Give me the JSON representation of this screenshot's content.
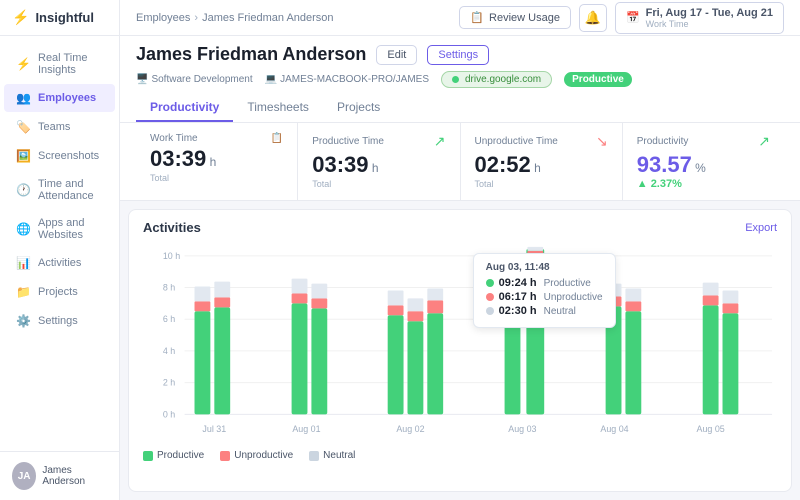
{
  "app": {
    "name": "Insightful"
  },
  "sidebar": {
    "items": [
      {
        "id": "realtime",
        "label": "Real Time Insights",
        "icon": "⚡"
      },
      {
        "id": "employees",
        "label": "Employees",
        "icon": "👥",
        "active": true
      },
      {
        "id": "teams",
        "label": "Teams",
        "icon": "🏷️"
      },
      {
        "id": "screenshots",
        "label": "Screenshots",
        "icon": "🖼️"
      },
      {
        "id": "timeattendance",
        "label": "Time and Attendance",
        "icon": "🕐"
      },
      {
        "id": "appswebsites",
        "label": "Apps and Websites",
        "icon": "🌐"
      },
      {
        "id": "activities",
        "label": "Activities",
        "icon": "📊"
      },
      {
        "id": "projects",
        "label": "Projects",
        "icon": "📁"
      },
      {
        "id": "settings",
        "label": "Settings",
        "icon": "⚙️"
      }
    ],
    "user": {
      "name": "James Anderson",
      "initials": "JA"
    }
  },
  "topbar": {
    "breadcrumb": {
      "parent": "Employees",
      "current": "James Friedman Anderson"
    },
    "review_button": "Review Usage",
    "date_range": "Fri, Aug 17 - Tue, Aug 21",
    "date_sub": "Work Time"
  },
  "profile": {
    "name": "James Friedman Anderson",
    "edit_label": "Edit",
    "settings_label": "Settings",
    "department": "Software Development",
    "computer": "JAMES-MACBOOK-PRO/JAMES",
    "active_url": "drive.google.com",
    "active_badge": "Productive"
  },
  "tabs": [
    {
      "id": "productivity",
      "label": "Productivity",
      "active": true
    },
    {
      "id": "timesheets",
      "label": "Timesheets",
      "active": false
    },
    {
      "id": "projects",
      "label": "Projects",
      "active": false
    }
  ],
  "stats": {
    "work_time": {
      "label": "Work Time",
      "value": "03:39",
      "unit": "h",
      "sub": "Total"
    },
    "productive_time": {
      "label": "Productive Time",
      "value": "03:39",
      "unit": "h",
      "sub": "Total"
    },
    "unproductive_time": {
      "label": "Unproductive Time",
      "value": "02:52",
      "unit": "h",
      "sub": "Total"
    },
    "productivity": {
      "label": "Productivity",
      "value": "93.57",
      "unit": "%",
      "change": "▲ 2.37%"
    }
  },
  "chart": {
    "title": "Activities",
    "export_label": "Export",
    "tooltip": {
      "date": "Aug 03, 11:48",
      "productive": {
        "time": "09:24 h",
        "label": "Productive"
      },
      "unproductive": {
        "time": "06:17 h",
        "label": "Unproductive"
      },
      "neutral": {
        "time": "02:30 h",
        "label": "Neutral"
      }
    },
    "x_labels": [
      "Jul 31",
      "Aug 01",
      "Aug 02",
      "Aug 03",
      "Aug 04",
      "Aug 05"
    ],
    "y_labels": [
      "10 h",
      "8 h",
      "6 h",
      "4 h",
      "2 h",
      "0 h"
    ],
    "legend": [
      {
        "label": "Productive",
        "color": "#43d17a"
      },
      {
        "label": "Unproductive",
        "color": "#fc8181"
      },
      {
        "label": "Neutral",
        "color": "#cbd5e0"
      }
    ],
    "bars": [
      {
        "date": "Jul 31",
        "productive": 0.6,
        "unproductive": 0.1,
        "neutral": 0.15
      },
      {
        "date": "Aug 01",
        "productive": 0.62,
        "unproductive": 0.08,
        "neutral": 0.18
      },
      {
        "date": "Aug 02a",
        "productive": 0.55,
        "unproductive": 0.12,
        "neutral": 0.12
      },
      {
        "date": "Aug 02b",
        "productive": 0.5,
        "unproductive": 0.1,
        "neutral": 0.1
      },
      {
        "date": "Aug 02c",
        "productive": 0.58,
        "unproductive": 0.15,
        "neutral": 0.08
      },
      {
        "date": "Aug 03a",
        "productive": 0.62,
        "unproductive": 0.14,
        "neutral": 0.1
      },
      {
        "date": "Aug 03b",
        "productive": 0.92,
        "unproductive": 0.6,
        "neutral": 0.24
      },
      {
        "date": "Aug 04a",
        "productive": 0.65,
        "unproductive": 0.1,
        "neutral": 0.14
      },
      {
        "date": "Aug 04b",
        "productive": 0.6,
        "unproductive": 0.08,
        "neutral": 0.12
      },
      {
        "date": "Aug 05a",
        "productive": 0.62,
        "unproductive": 0.1,
        "neutral": 0.15
      },
      {
        "date": "Aug 05b",
        "productive": 0.58,
        "unproductive": 0.12,
        "neutral": 0.12
      }
    ]
  }
}
